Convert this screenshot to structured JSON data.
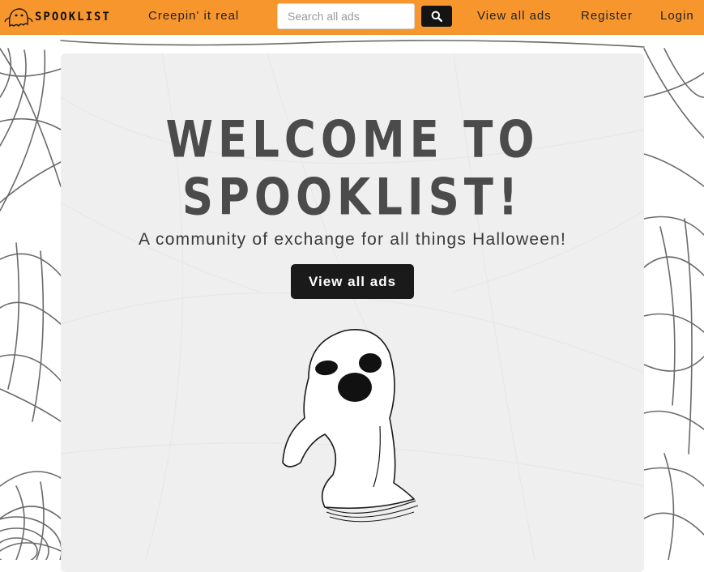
{
  "navbar": {
    "brand": "SPOOKLIST",
    "brand_icon": "ghost-icon",
    "tagline": "Creepin' it real",
    "search": {
      "placeholder": "Search all ads",
      "value": "",
      "button_icon": "search-icon"
    },
    "links": [
      "View all ads",
      "Register",
      "Login"
    ],
    "background_color": "#f8962e"
  },
  "hero": {
    "title": "WELCOME TO SPOOKLIST!",
    "subtitle": "A community of exchange for all things Halloween!",
    "button_label": "View all ads",
    "illustration": "ghost-illustration"
  }
}
